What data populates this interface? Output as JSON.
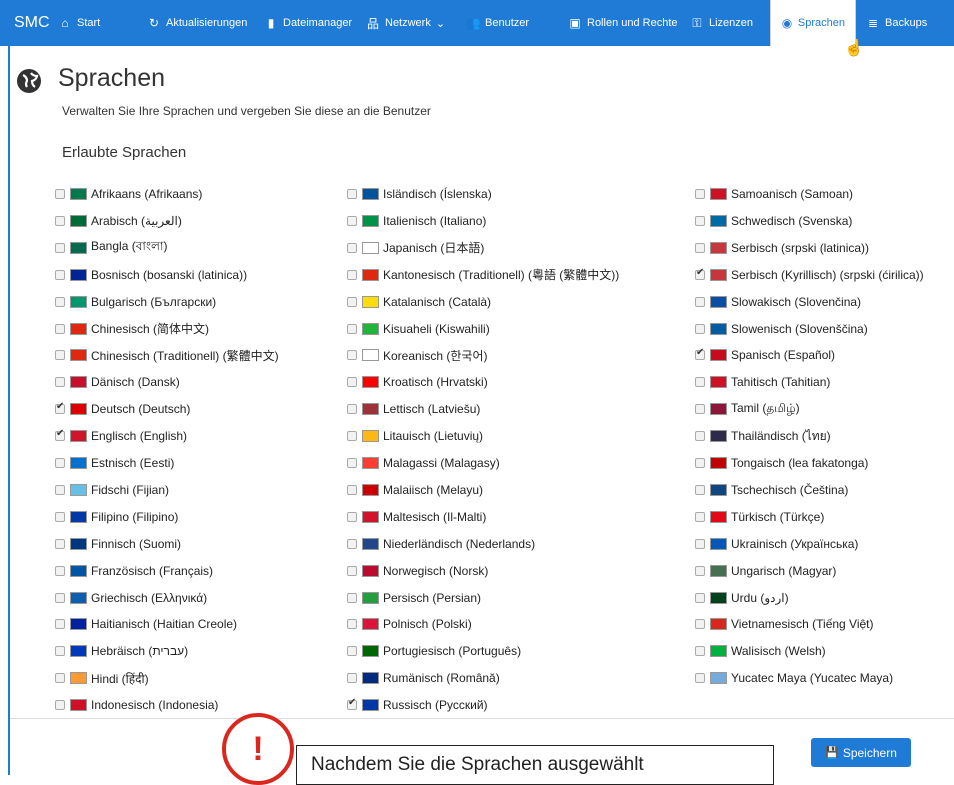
{
  "nav": {
    "brand": "SMC",
    "items": [
      {
        "label": "Start",
        "icon": "home-icon",
        "glyph": "⌂"
      },
      {
        "label": "Aktualisierungen",
        "icon": "refresh-icon",
        "glyph": "↻"
      },
      {
        "label": "Dateimanager",
        "icon": "file-icon",
        "glyph": "▮"
      },
      {
        "label": "Netzwerk",
        "icon": "network-icon",
        "glyph": "品"
      },
      {
        "label": "Benutzer",
        "icon": "users-icon",
        "glyph": "👥"
      },
      {
        "label": "Rollen und Rechte",
        "icon": "id-card-icon",
        "glyph": "▣"
      },
      {
        "label": "Lizenzen",
        "icon": "key-icon",
        "glyph": "⚿"
      },
      {
        "label": "Sprachen",
        "icon": "globe-icon",
        "glyph": "◉"
      },
      {
        "label": "Backups",
        "icon": "database-icon",
        "glyph": "≣"
      }
    ],
    "netzwerk_caret": "⌄",
    "active": "Sprachen"
  },
  "page": {
    "title": "Sprachen",
    "subtitle": "Verwalten Sie Ihre Sprachen und vergeben Sie diese an die Benutzer",
    "section_title": "Erlaubte Sprachen"
  },
  "languages": {
    "col1": [
      {
        "label": "Afrikaans (Afrikaans)",
        "checked": false
      },
      {
        "label": "Arabisch (العربية)",
        "checked": false
      },
      {
        "label": "Bangla (বাংলা)",
        "checked": false
      },
      {
        "label": "Bosnisch (bosanski (latinica))",
        "checked": false
      },
      {
        "label": "Bulgarisch (Български)",
        "checked": false
      },
      {
        "label": "Chinesisch (简体中文)",
        "checked": false
      },
      {
        "label": "Chinesisch (Traditionell) (繁體中文)",
        "checked": false
      },
      {
        "label": "Dänisch (Dansk)",
        "checked": false
      },
      {
        "label": "Deutsch (Deutsch)",
        "checked": true
      },
      {
        "label": "Englisch (English)",
        "checked": true
      },
      {
        "label": "Estnisch (Eesti)",
        "checked": false
      },
      {
        "label": "Fidschi (Fijian)",
        "checked": false
      },
      {
        "label": "Filipino (Filipino)",
        "checked": false
      },
      {
        "label": "Finnisch (Suomi)",
        "checked": false
      },
      {
        "label": "Französisch (Français)",
        "checked": false
      },
      {
        "label": "Griechisch (Ελληνικά)",
        "checked": false
      },
      {
        "label": "Haitianisch (Haitian Creole)",
        "checked": false
      },
      {
        "label": "Hebräisch (עברית)",
        "checked": false
      },
      {
        "label": "Hindi (हिंदी)",
        "checked": false
      },
      {
        "label": "Indonesisch (Indonesia)",
        "checked": false
      }
    ],
    "col2": [
      {
        "label": "Isländisch (Íslenska)",
        "checked": false
      },
      {
        "label": "Italienisch (Italiano)",
        "checked": false
      },
      {
        "label": "Japanisch (日本語)",
        "checked": false
      },
      {
        "label": "Kantonesisch (Traditionell) (粵語 (繁體中文))",
        "checked": false
      },
      {
        "label": "Katalanisch (Català)",
        "checked": false
      },
      {
        "label": "Kisuaheli (Kiswahili)",
        "checked": false
      },
      {
        "label": "Koreanisch (한국어)",
        "checked": false
      },
      {
        "label": "Kroatisch (Hrvatski)",
        "checked": false
      },
      {
        "label": "Lettisch (Latviešu)",
        "checked": false
      },
      {
        "label": "Litauisch (Lietuvių)",
        "checked": false
      },
      {
        "label": "Malagassi (Malagasy)",
        "checked": false
      },
      {
        "label": "Malaiisch (Melayu)",
        "checked": false
      },
      {
        "label": "Maltesisch (Il-Malti)",
        "checked": false
      },
      {
        "label": "Niederländisch (Nederlands)",
        "checked": false
      },
      {
        "label": "Norwegisch (Norsk)",
        "checked": false
      },
      {
        "label": "Persisch (Persian)",
        "checked": false
      },
      {
        "label": "Polnisch (Polski)",
        "checked": false
      },
      {
        "label": "Portugiesisch (Português)",
        "checked": false
      },
      {
        "label": "Rumänisch (Română)",
        "checked": false
      },
      {
        "label": "Russisch (Русский)",
        "checked": true
      }
    ],
    "col3": [
      {
        "label": "Samoanisch (Samoan)",
        "checked": false
      },
      {
        "label": "Schwedisch (Svenska)",
        "checked": false
      },
      {
        "label": "Serbisch (srpski (latinica))",
        "checked": false
      },
      {
        "label": "Serbisch (Kyrillisch) (srpski (ćirilica))",
        "checked": true
      },
      {
        "label": "Slowakisch (Slovenčina)",
        "checked": false
      },
      {
        "label": "Slowenisch (Slovenščina)",
        "checked": false
      },
      {
        "label": "Spanisch (Español)",
        "checked": true
      },
      {
        "label": "Tahitisch (Tahitian)",
        "checked": false
      },
      {
        "label": "Tamil (தமிழ்)",
        "checked": false
      },
      {
        "label": "Thailändisch (ไทย)",
        "checked": false
      },
      {
        "label": "Tongaisch (lea fakatonga)",
        "checked": false
      },
      {
        "label": "Tschechisch (Čeština)",
        "checked": false
      },
      {
        "label": "Türkisch (Türkçe)",
        "checked": false
      },
      {
        "label": "Ukrainisch (Українська)",
        "checked": false
      },
      {
        "label": "Ungarisch (Magyar)",
        "checked": false
      },
      {
        "label": "Urdu (اردو)",
        "checked": false
      },
      {
        "label": "Vietnamesisch (Tiếng Việt)",
        "checked": false
      },
      {
        "label": "Walisisch (Welsh)",
        "checked": false
      },
      {
        "label": "Yucatec Maya (Yucatec Maya)",
        "checked": false
      }
    ]
  },
  "flag_colors": {
    "col1": [
      "#007a4d",
      "#006c35",
      "#006a4e",
      "#002395",
      "#00966e",
      "#de2910",
      "#de2910",
      "#c8102e",
      "#dd0000",
      "#cf142b",
      "#0072ce",
      "#68bfe5",
      "#0038a8",
      "#003580",
      "#0055a4",
      "#0d5eaf",
      "#00209f",
      "#0038b8",
      "#ff9933",
      "#ce1126"
    ],
    "col2": [
      "#02529c",
      "#009246",
      "#ffffff",
      "#de2910",
      "#fcdd09",
      "#1eb53a",
      "#ffffff",
      "#ff0000",
      "#9e3039",
      "#fdb913",
      "#fc3d32",
      "#cc0001",
      "#cf142b",
      "#21468b",
      "#ba0c2f",
      "#239f40",
      "#dc143c",
      "#006600",
      "#002b7f",
      "#0039a6"
    ],
    "col3": [
      "#ce1126",
      "#006aa7",
      "#c6363c",
      "#c6363c",
      "#0b4ea2",
      "#005da4",
      "#c60b1e",
      "#ce1126",
      "#8d153a",
      "#2d2a4a",
      "#c10000",
      "#11457e",
      "#e30a17",
      "#0057b7",
      "#477050",
      "#01411c",
      "#da251d",
      "#00b140",
      "#75aadb"
    ]
  },
  "actions": {
    "save_label": "Speichern",
    "save_icon": "save-icon"
  },
  "overlay": {
    "warning_mark": "!",
    "callout_text": "Nachdem Sie die Sprachen ausgewählt"
  }
}
